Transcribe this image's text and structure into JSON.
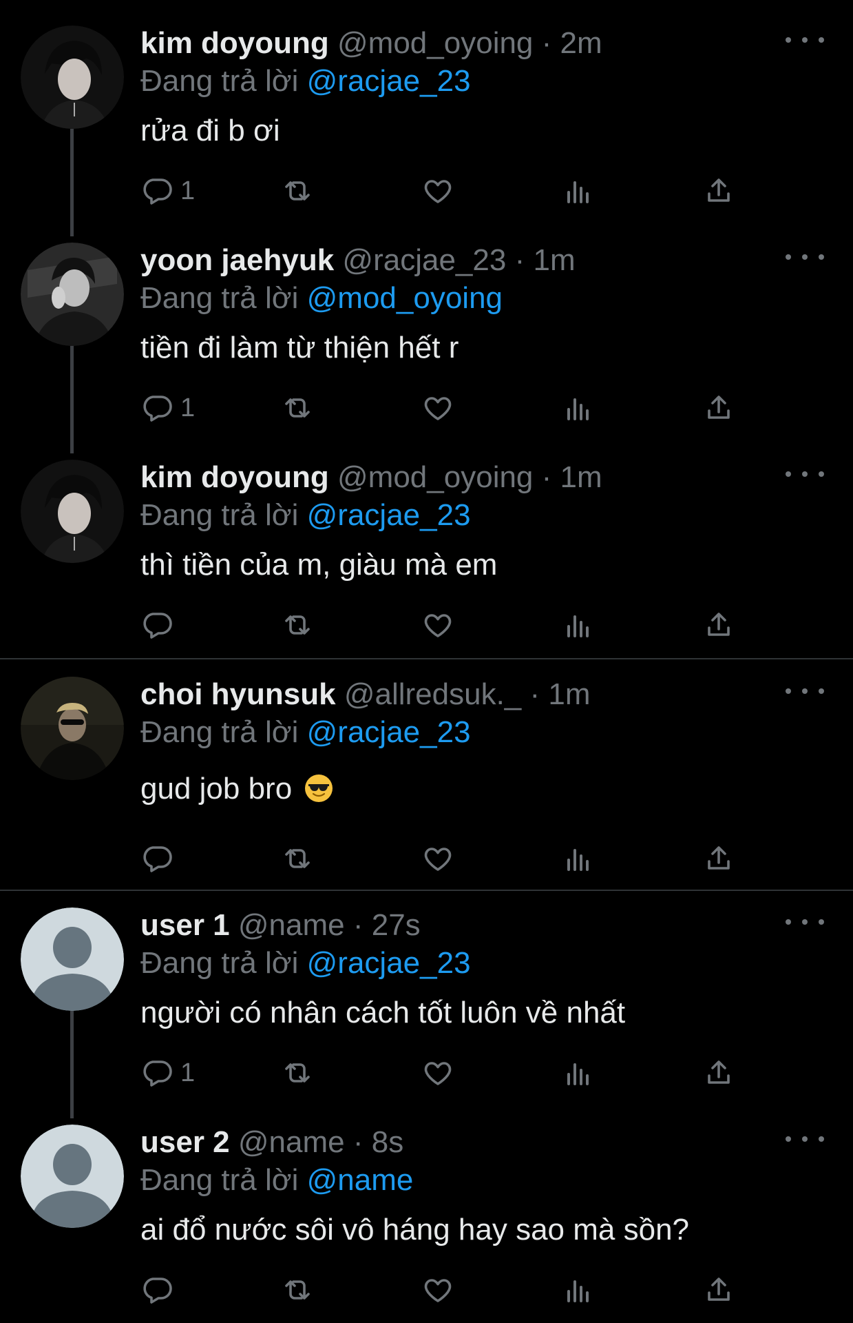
{
  "colors": {
    "background": "#000000",
    "text": "#e7e9ea",
    "muted": "#71767b",
    "link": "#1d9bf0",
    "divider": "#2f3336"
  },
  "tweets": [
    {
      "name": "kim doyoung",
      "handle": "@mod_oyoing",
      "sep": "·",
      "time": "2m",
      "reply_prefix": "Đang trả lời",
      "reply_to": "@racjae_23",
      "text": "rửa đi b ơi",
      "reply_count": "1",
      "emoji": "",
      "avatar": "photo-dark-portrait"
    },
    {
      "name": "yoon jaehyuk",
      "handle": "@racjae_23",
      "sep": "·",
      "time": "1m",
      "reply_prefix": "Đang trả lời",
      "reply_to": "@mod_oyoing",
      "text": "tiền đi làm từ thiện hết r",
      "reply_count": "1",
      "emoji": "",
      "avatar": "photo-bw-portrait"
    },
    {
      "name": "kim doyoung",
      "handle": "@mod_oyoing",
      "sep": "·",
      "time": "1m",
      "reply_prefix": "Đang trả lời",
      "reply_to": "@racjae_23",
      "text": "thì tiền của m, giàu mà em",
      "reply_count": "",
      "emoji": "",
      "avatar": "photo-dark-portrait"
    },
    {
      "name": "choi hyunsuk",
      "handle": "@allredsuk._",
      "sep": "·",
      "time": "1m",
      "reply_prefix": "Đang trả lời",
      "reply_to": "@racjae_23",
      "text": "gud job bro",
      "reply_count": "",
      "emoji": "smiling-face-with-sunglasses",
      "avatar": "photo-sunglasses-portrait"
    },
    {
      "name": "user 1",
      "handle": "@name",
      "sep": "·",
      "time": "27s",
      "reply_prefix": "Đang trả lời",
      "reply_to": "@racjae_23",
      "text": "người có nhân cách tốt luôn về nhất",
      "reply_count": "1",
      "emoji": "",
      "avatar": "default-avatar"
    },
    {
      "name": "user 2",
      "handle": "@name",
      "sep": "·",
      "time": "8s",
      "reply_prefix": "Đang trả lời",
      "reply_to": "@name",
      "text": "ai đổ nước sôi vô háng hay sao mà sồn?",
      "reply_count": "",
      "emoji": "",
      "avatar": "default-avatar"
    }
  ],
  "icons": [
    "reply-icon",
    "retweet-icon",
    "like-icon",
    "views-icon",
    "share-icon",
    "more-icon"
  ]
}
